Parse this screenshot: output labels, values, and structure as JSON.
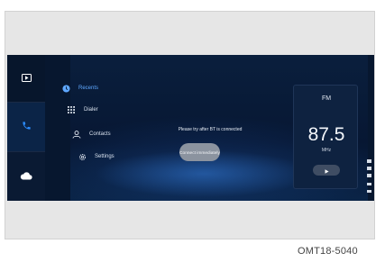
{
  "left_rail": {
    "items": [
      {
        "name": "media",
        "icon": "media-player-icon",
        "active": false
      },
      {
        "name": "phone",
        "icon": "phone-icon",
        "active": true,
        "color": "#2b8cff"
      },
      {
        "name": "cloud",
        "icon": "cloud-icon",
        "active": false
      }
    ]
  },
  "menu": {
    "items": [
      {
        "label": "Recents",
        "icon": "clock-icon",
        "selected": true
      },
      {
        "label": "Dialer",
        "icon": "keypad-icon"
      },
      {
        "label": "Contacts",
        "icon": "contacts-icon"
      },
      {
        "label": "Settings",
        "icon": "gear-icon"
      }
    ]
  },
  "center": {
    "message": "Please try after BT is connected",
    "connect_button": "Connect immediately"
  },
  "radio": {
    "band": "FM",
    "frequency": "87.5",
    "unit": "MHz"
  },
  "caption": "OMT18-5040",
  "colors": {
    "screen_background": "#07172f",
    "accent": "#2b8cff",
    "selected_text": "#5fa8ff"
  }
}
